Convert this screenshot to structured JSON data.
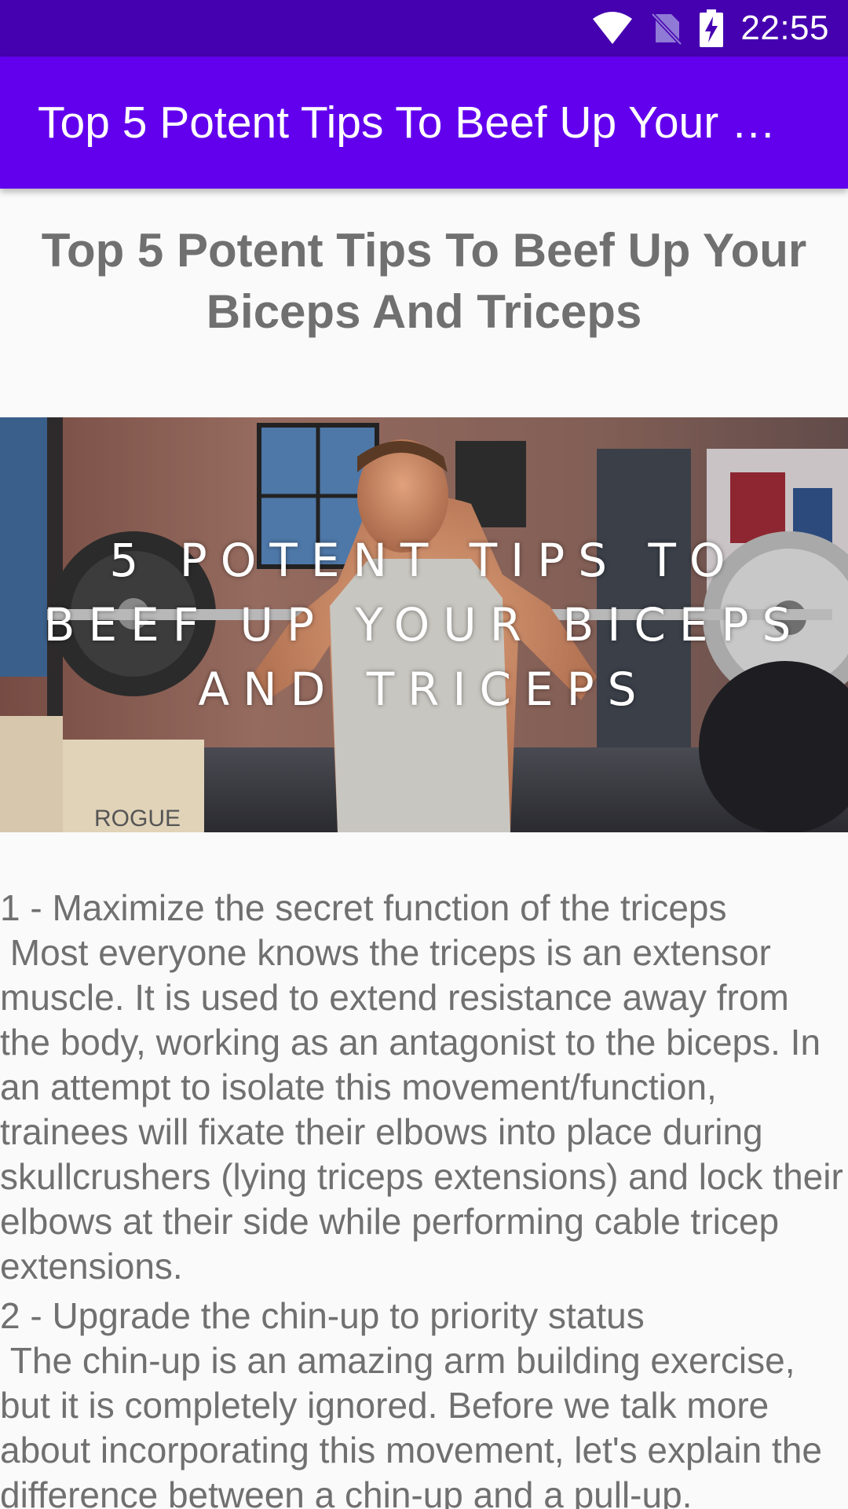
{
  "status_bar": {
    "time": "22:55",
    "icons": [
      "wifi-icon",
      "no-sim-icon",
      "battery-charging-icon"
    ]
  },
  "app_bar": {
    "title": "Top 5 Potent Tips To Beef Up Your Biceps And Triceps"
  },
  "article": {
    "heading": "Top 5 Potent Tips To Beef Up Your Biceps And Triceps",
    "hero_caption": "5 POTENT TIPS TO BEEF UP YOUR BICEPS AND TRICEPS",
    "sections": [
      {
        "title": "1 - Maximize the secret function of the triceps",
        "body": " Most everyone knows the triceps is an extensor muscle. It is used to extend resistance away from the body, working as an antagonist to the biceps. In an attempt to isolate this movement/function, trainees will fixate their elbows into place during skullcrushers (lying triceps extensions) and lock their elbows at their side while performing cable tricep extensions."
      },
      {
        "title": "2 - Upgrade the chin-up to priority status",
        "body": " The chin-up is an amazing arm building exercise, but it is completely ignored. Before we talk more about incorporating this movement, let's explain the difference between a chin-up and a pull-up."
      }
    ]
  },
  "colors": {
    "status_bar": "#4500b0",
    "app_bar": "#6200ee",
    "text": "#707070",
    "background": "#fafafa"
  }
}
